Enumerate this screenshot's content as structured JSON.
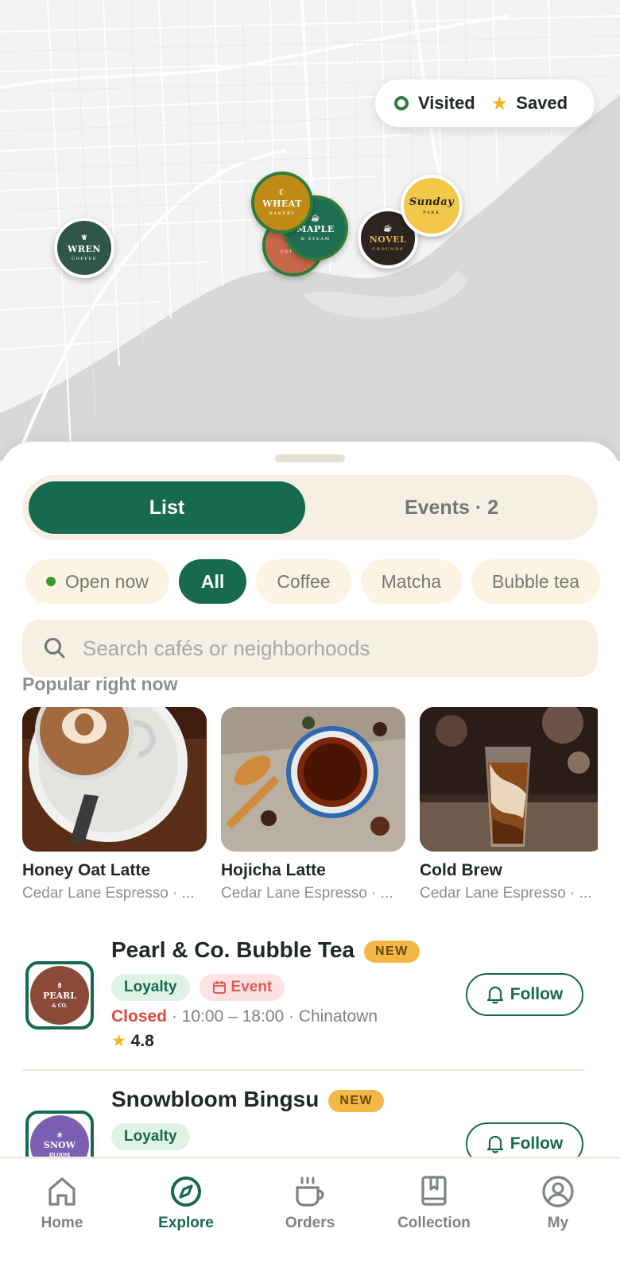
{
  "map": {
    "legend": {
      "visited_label": "Visited",
      "saved_label": "Saved"
    },
    "pins": [
      {
        "name": "wren",
        "title": "WREN",
        "subtitle": "COFFEE",
        "color": "#2f5747"
      },
      {
        "name": "wheat",
        "title": "WHEAT",
        "subtitle": "BAKERY",
        "color": "#c08a16"
      },
      {
        "name": "maple",
        "title": "MAPLE",
        "subtitle": "& STEAM",
        "color": "#1f6e53"
      },
      {
        "name": "bl",
        "title": "BL",
        "subtitle": "COFFEE",
        "color": "#c9674a"
      },
      {
        "name": "novel",
        "title": "NOVEL",
        "subtitle": "GROUNDS",
        "color": "#2b2421"
      },
      {
        "name": "sunday",
        "title": "Sunday",
        "subtitle": "PARK",
        "color": "#f2c84b"
      }
    ]
  },
  "sheet": {
    "segment": {
      "list_label": "List",
      "events_label": "Events · 2"
    },
    "chips": [
      "Open now",
      "All",
      "Coffee",
      "Matcha",
      "Bubble tea"
    ],
    "search": {
      "placeholder": "Search cafés or neighborhoods"
    },
    "popular": {
      "heading": "Popular right now",
      "items": [
        {
          "name": "Honey Oat Latte",
          "cafe": "Cedar Lane Espresso · ..."
        },
        {
          "name": "Hojicha Latte",
          "cafe": "Cedar Lane Espresso · ..."
        },
        {
          "name": "Cold Brew",
          "cafe": "Cedar Lane Espresso · ..."
        }
      ]
    },
    "cafes": [
      {
        "name": "Pearl & Co. Bubble Tea",
        "badge": "NEW",
        "logo_title": "PEARL",
        "logo_sub": "& CO.",
        "logo_color": "#8b4a38",
        "tags": {
          "loyalty": "Loyalty",
          "event": "Event"
        },
        "status": "Closed",
        "hours": "· 10:00 – 18:00 · Chinatown",
        "rating": "4.8",
        "follow_label": "Follow"
      },
      {
        "name": "Snowbloom Bingsu",
        "badge": "NEW",
        "logo_title": "SNOW",
        "logo_sub": "BLOOM",
        "logo_color": "#7a5fb3",
        "tags": {
          "loyalty": "Loyalty"
        },
        "follow_label": "Follow"
      }
    ]
  },
  "nav": {
    "items": [
      {
        "label": "Home",
        "icon": "home-icon"
      },
      {
        "label": "Explore",
        "icon": "compass-icon",
        "active": true
      },
      {
        "label": "Orders",
        "icon": "cup-icon"
      },
      {
        "label": "Collection",
        "icon": "book-icon"
      },
      {
        "label": "My",
        "icon": "profile-icon"
      }
    ]
  },
  "colors": {
    "accent": "#17694f",
    "cream": "#f5efe4",
    "star": "#f3b51e",
    "closed": "#dd4a3f"
  }
}
